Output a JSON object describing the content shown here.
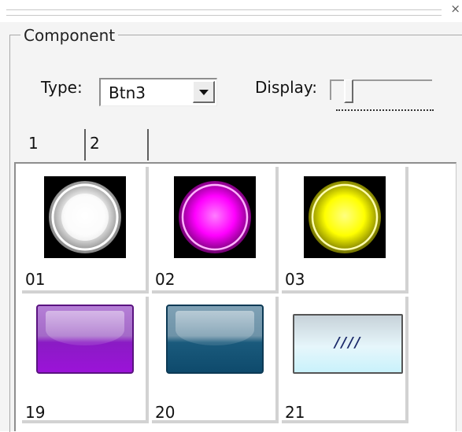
{
  "window": {
    "close_label": "×"
  },
  "component": {
    "title": "Component",
    "type_label": "Type:",
    "type_value": "Btn3",
    "display_label": "Display:",
    "display_level": 0.15
  },
  "tabs": [
    {
      "label": "1",
      "active": true
    },
    {
      "label": "2",
      "active": false
    }
  ],
  "items": [
    {
      "label": "01",
      "style": "round",
      "color": "#ffffff"
    },
    {
      "label": "02",
      "style": "round",
      "color": "#ff00ff"
    },
    {
      "label": "03",
      "style": "round",
      "color": "#ffff00"
    },
    {
      "label": "19",
      "style": "square",
      "color": "#9b13d8"
    },
    {
      "label": "20",
      "style": "square",
      "color": "#0e4a6c"
    },
    {
      "label": "21",
      "style": "sky",
      "text": "////",
      "color": "#c9f2fb"
    }
  ],
  "icons": {
    "close": "close-icon",
    "dropdown": "chevron-down-icon"
  }
}
